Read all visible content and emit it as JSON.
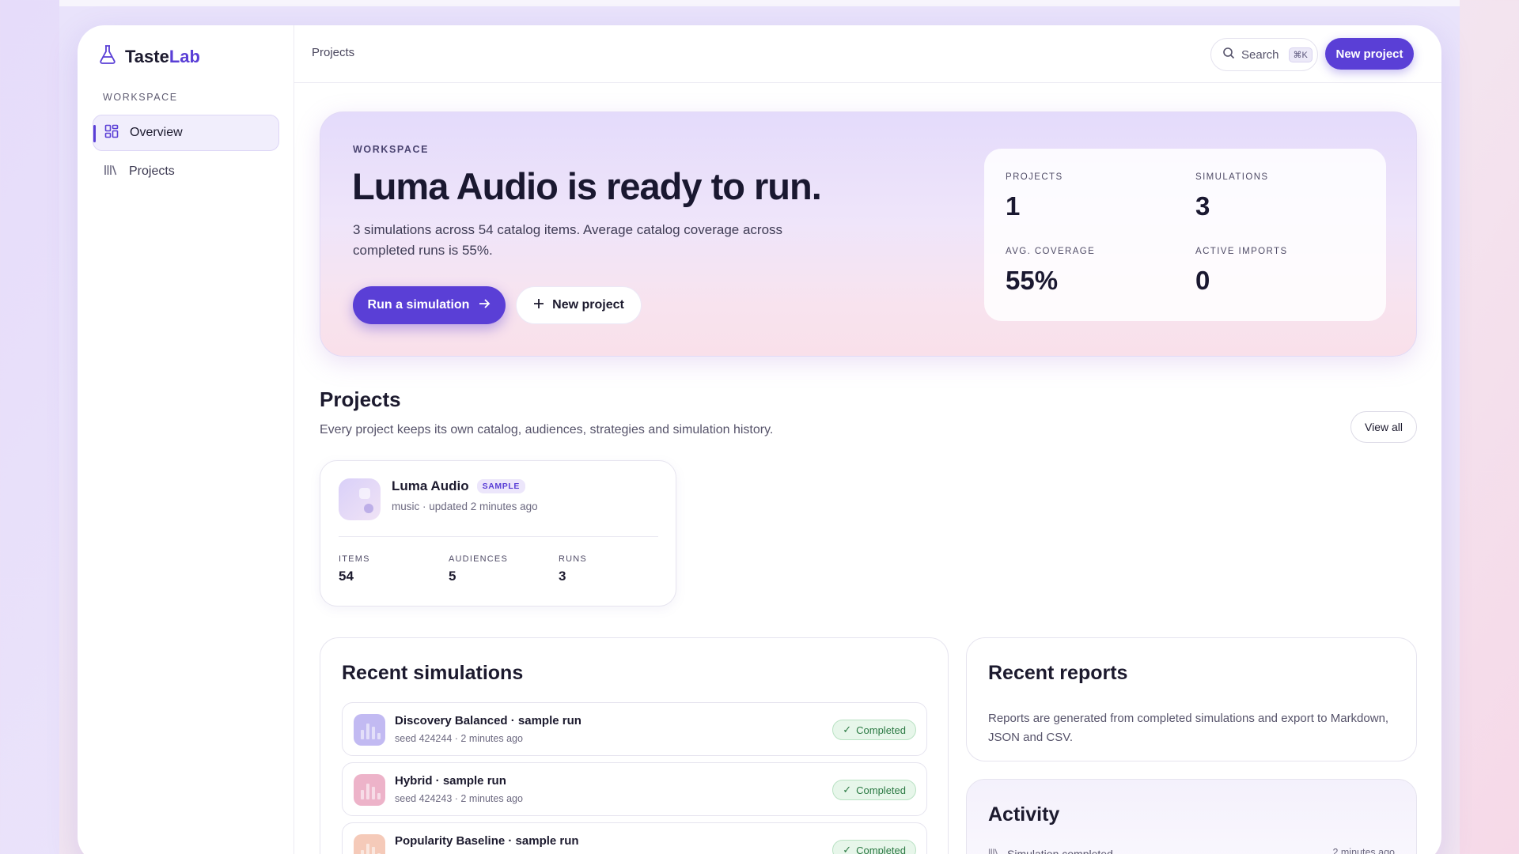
{
  "brand": {
    "name_part1": "Taste",
    "name_part2": "Lab"
  },
  "sidebar": {
    "section_label": "WORKSPACE",
    "items": [
      {
        "label": "Overview",
        "icon": "grid-icon",
        "active": true
      },
      {
        "label": "Projects",
        "icon": "library-icon",
        "active": false
      }
    ]
  },
  "header": {
    "breadcrumb": "Projects",
    "search_label": "Search",
    "search_shortcut": "⌘K",
    "new_project_label": "New project"
  },
  "hero": {
    "eyebrow": "WORKSPACE",
    "title": "Luma Audio is ready to run.",
    "subtitle": "3 simulations across 54 catalog items. Average catalog coverage across completed runs is 55%.",
    "primary_label": "Run a simulation",
    "secondary_label": "New project",
    "stats": [
      {
        "label": "PROJECTS",
        "value": "1"
      },
      {
        "label": "SIMULATIONS",
        "value": "3"
      },
      {
        "label": "AVG. COVERAGE",
        "value": "55%"
      },
      {
        "label": "ACTIVE IMPORTS",
        "value": "0"
      }
    ]
  },
  "projects": {
    "title": "Projects",
    "subtitle": "Every project keeps its own catalog, audiences, strategies and simulation history.",
    "view_all_label": "View all",
    "cards": [
      {
        "name": "Luma Audio",
        "badge": "SAMPLE",
        "meta": "music · updated 2 minutes ago",
        "stats": [
          {
            "label": "ITEMS",
            "value": "54"
          },
          {
            "label": "AUDIENCES",
            "value": "5"
          },
          {
            "label": "RUNS",
            "value": "3"
          }
        ]
      }
    ]
  },
  "simulations": {
    "title": "Recent simulations",
    "rows": [
      {
        "title": "Discovery Balanced · sample run",
        "meta": "seed 424244 · 2 minutes ago",
        "status": "Completed",
        "color": "#b8aef0"
      },
      {
        "title": "Hybrid · sample run",
        "meta": "seed 424243 · 2 minutes ago",
        "status": "Completed",
        "color": "#eaa6c0"
      },
      {
        "title": "Popularity Baseline · sample run",
        "meta": "",
        "status": "Completed",
        "color": "#f4c1ad"
      }
    ]
  },
  "reports": {
    "title": "Recent reports",
    "text": "Reports are generated from completed simulations and export to Markdown, JSON and CSV."
  },
  "activity": {
    "title": "Activity",
    "rows": [
      {
        "label": "Simulation completed",
        "time": "2 minutes ago"
      }
    ]
  },
  "colors": {
    "accent": "#5a3fd6",
    "success": "#2c7a44"
  }
}
